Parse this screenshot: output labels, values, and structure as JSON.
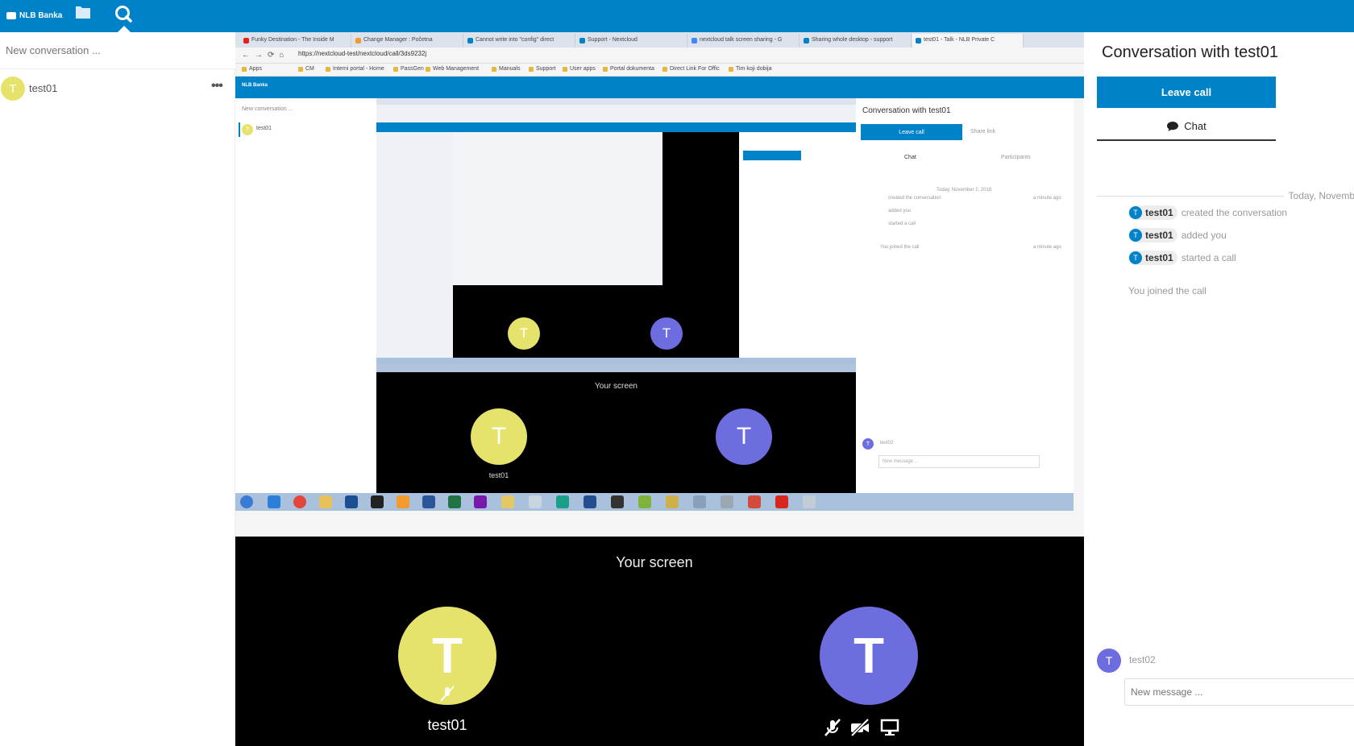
{
  "header": {
    "logo_text": "NLB Banka",
    "accent": "#0082c9"
  },
  "left": {
    "new_conversation_placeholder": "New conversation ...",
    "conversation": {
      "avatar_letter": "T",
      "name": "test01",
      "menu": "•••"
    }
  },
  "chrome": {
    "tabs": [
      {
        "label": "Funky Destination - The Inside M",
        "color": "#e62117"
      },
      {
        "label": "Change Manager : Početna",
        "color": "#f09c2c"
      },
      {
        "label": "Cannot write into \"config\" direct",
        "color": "#0082c9"
      },
      {
        "label": "Support - Nextcloud",
        "color": "#0082c9"
      },
      {
        "label": "nextcloud talk screen sharing - G",
        "color": "#4285f4"
      },
      {
        "label": "Sharing whole desktop - support",
        "color": "#0082c9"
      },
      {
        "label": "test01 - Talk - NLB Private C",
        "color": "#0082c9"
      }
    ],
    "url": "https://nextcloud-test/nextcloud/call/3ds9232j",
    "bookmarks": [
      "Apps",
      "CM",
      "Interni portal - Home",
      "PassGen",
      "Web Management",
      "Manuals",
      "Support",
      "User apps",
      "Portal dokumenta",
      "Direct Link For Offic",
      "Tim koji dobija"
    ]
  },
  "inner": {
    "new_conversation_placeholder": "New conversation ...",
    "conversation_name": "test01",
    "right_title": "Conversation with test01",
    "leave_call": "Leave call",
    "share_link": "Share link",
    "chat": "Chat",
    "participants": "Participants",
    "date": "Today, November 2, 2018",
    "messages": [
      {
        "user": "test01",
        "text": "created the conversation",
        "time": "a minute ago"
      },
      {
        "user": "test01",
        "text": "added you",
        "time": ""
      },
      {
        "user": "test01",
        "text": "started a call",
        "time": ""
      }
    ],
    "joined": "You joined the call",
    "joined_time": "a minute ago",
    "self_name": "test02",
    "message_placeholder": "New message ...",
    "your_screen": "Your screen",
    "tile_name": "test01"
  },
  "stage": {
    "your_screen": "Your screen",
    "participant_self": {
      "letter": "T",
      "name": "test01",
      "color": "#e5e36c"
    },
    "participant_other": {
      "letter": "T",
      "color": "#6d6de0"
    }
  },
  "right": {
    "title": "Conversation with test01",
    "leave_call_label": "Leave call",
    "chat_tab_label": "Chat",
    "date_separator": "Today, Novemb",
    "messages": [
      {
        "user": "test01",
        "text": "created the conversation"
      },
      {
        "user": "test01",
        "text": "added you"
      },
      {
        "user": "test01",
        "text": "started a call"
      }
    ],
    "joined": "You joined the call",
    "self": {
      "letter": "T",
      "name": "test02"
    },
    "message_placeholder": "New message ..."
  }
}
